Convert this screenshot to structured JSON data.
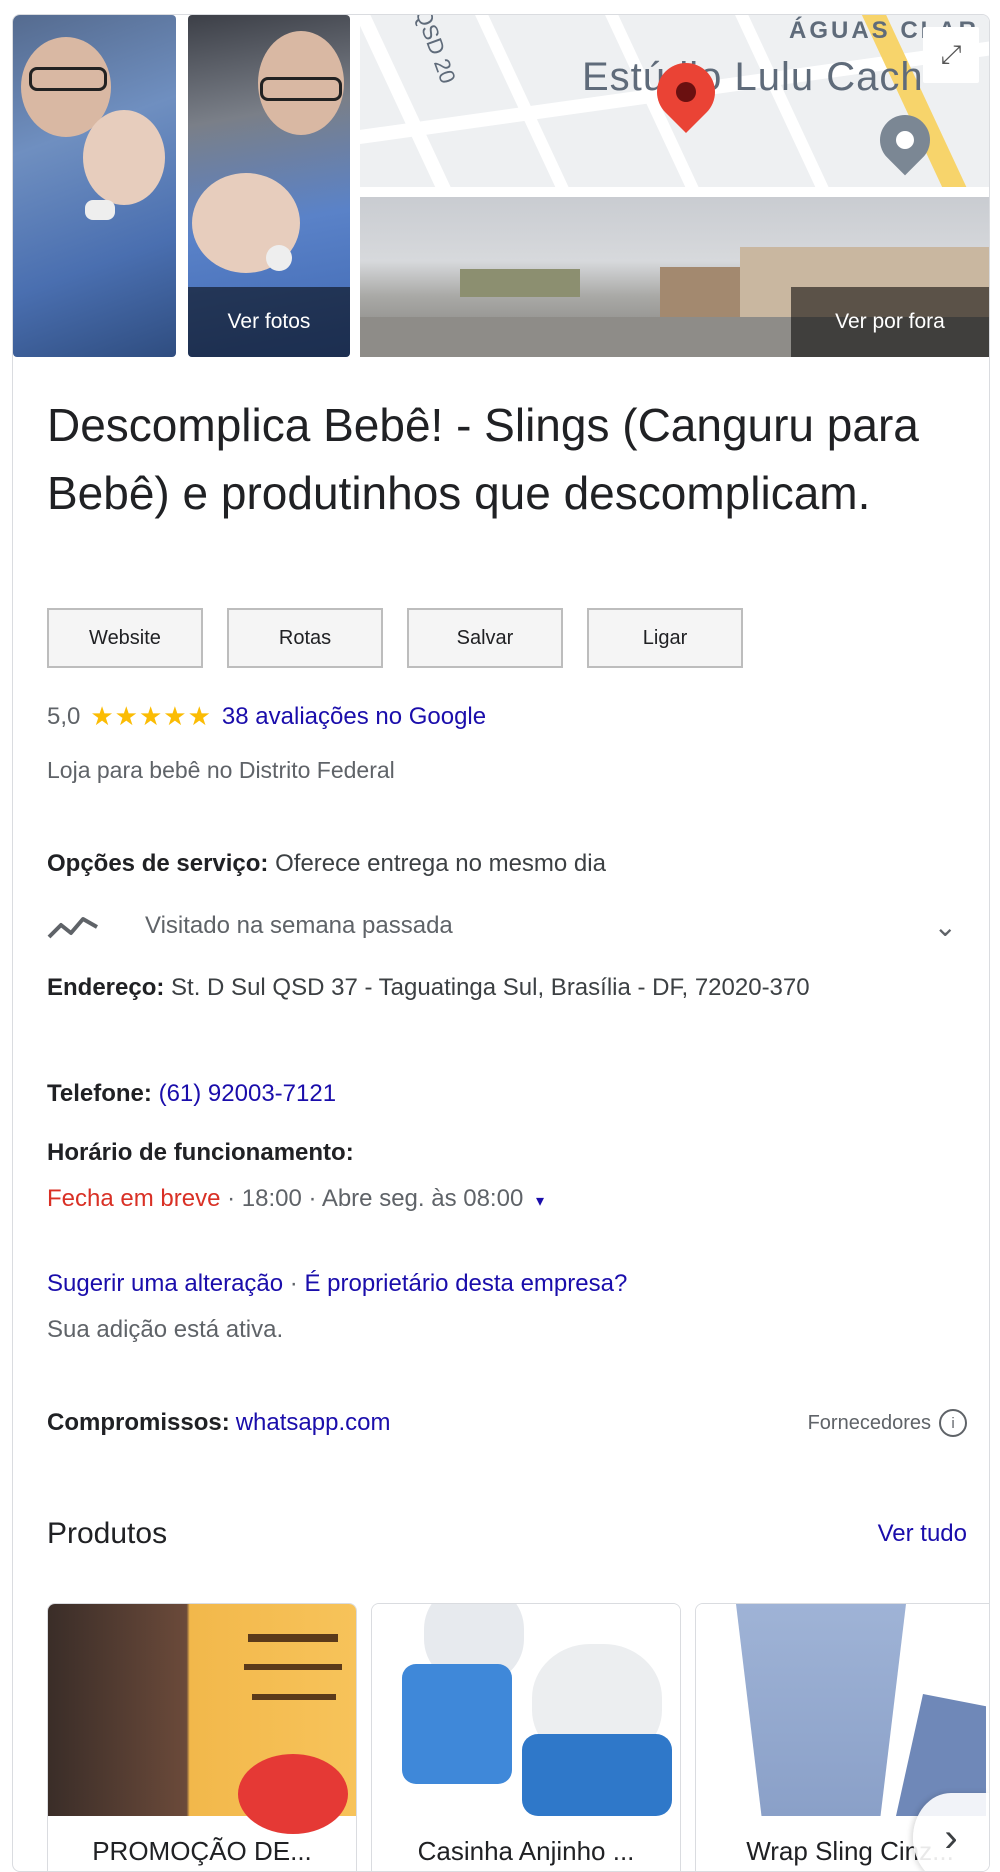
{
  "photos": {
    "see_photos_label": "Ver fotos",
    "see_outside_label": "Ver por fora"
  },
  "map": {
    "place_label": "Estúdio Lulu Cach",
    "district_label": "ÁGUAS CLAR",
    "street_label": "QSD 20",
    "pin_color": "#ea4335",
    "secondary_pin_color": "#7b8794"
  },
  "business": {
    "name": "Descomplica Bebê! - Slings (Canguru para Bebê) e produtinhos que descomplicam."
  },
  "actions": [
    "Website",
    "Rotas",
    "Salvar",
    "Ligar"
  ],
  "rating": {
    "score": "5,0",
    "stars": "★★★★★",
    "reviews_text": "38 avaliações no Google"
  },
  "category": "Loja para bebê no Distrito Federal",
  "service_options": {
    "label": "Opções de serviço:",
    "value": "Oferece entrega no mesmo dia"
  },
  "visited": {
    "label": "Visitado na semana passada"
  },
  "address": {
    "label": "Endereço:",
    "value": "St. D Sul QSD 37 - Taguatinga Sul, Brasília - DF, 72020-370"
  },
  "phone": {
    "label": "Telefone:",
    "value": "(61) 92003-7121"
  },
  "hours": {
    "label": "Horário de funcionamento:",
    "status": "Fecha em breve",
    "close_time": "18:00",
    "next_open": "Abre seg. às 08:00",
    "separator": " · "
  },
  "edit": {
    "suggest": "Sugerir uma alteração",
    "owner": "É proprietário desta empresa?",
    "separator": " · ",
    "note": "Sua adição está ativa."
  },
  "appointments": {
    "label": "Compromissos:",
    "value": "whatsapp.com",
    "providers": "Fornecedores"
  },
  "products": {
    "heading": "Produtos",
    "see_all": "Ver tudo",
    "items": [
      {
        "name": "PROMOÇÃO DE..."
      },
      {
        "name": "Casinha Anjinho ..."
      },
      {
        "name": "Wrap Sling Cinz..."
      }
    ]
  }
}
